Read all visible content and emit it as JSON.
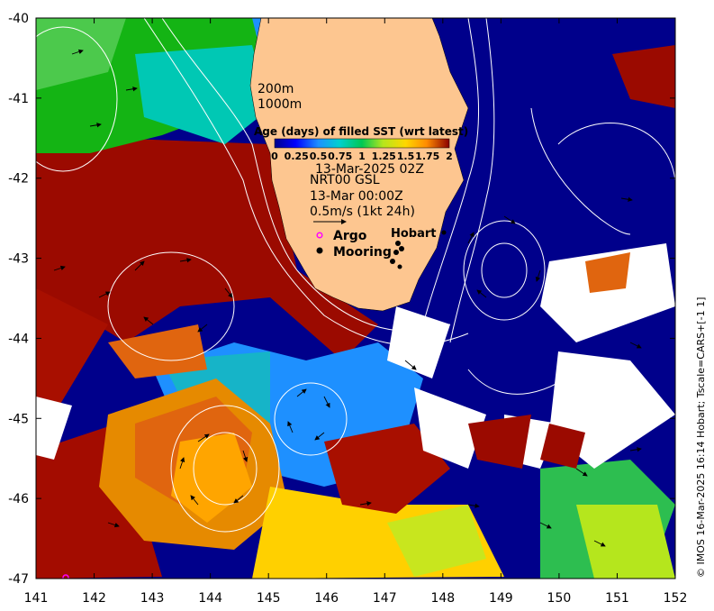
{
  "map": {
    "x_ticks": [
      "141",
      "142",
      "143",
      "144",
      "145",
      "146",
      "147",
      "148",
      "149",
      "150",
      "151",
      "152"
    ],
    "y_ticks": [
      "-40",
      "-41",
      "-42",
      "-43",
      "-44",
      "-45",
      "-46",
      "-47"
    ],
    "lon_range": [
      141,
      152
    ],
    "lat_range": [
      -47,
      -40
    ]
  },
  "legend": {
    "depth_200": "200m",
    "depth_1000": "1000m",
    "colorbar_title": "Age (days) of filled SST (wrt latest)",
    "colorbar_ticks": [
      "0",
      "0.25",
      "0.5",
      "0.75",
      "1",
      "1.25",
      "1.5",
      "1.75",
      "2"
    ],
    "colorbar_colors": [
      "#00008b",
      "#0000ff",
      "#1e90ff",
      "#00d0d0",
      "#00c853",
      "#b5e61d",
      "#ffd700",
      "#ff8c00",
      "#d2691e",
      "#8b0000"
    ],
    "sst_date": "13-Mar-2025 02Z",
    "current_label": "NRT00 GSL",
    "current_date": "13-Mar 00:00Z",
    "vector_scale": "0.5m/s (1kt 24h)",
    "argo_label": "Argo",
    "mooring_label": "Mooring",
    "hobart_label": "Hobart"
  },
  "credit": "© IMOS 16-Mar-2025 16:14 Hobart; Tscale=CARS+[-1 1]",
  "colors": {
    "land": "#fdc690",
    "dark_navy": "#00008b",
    "dark_red": "#9b0a00",
    "orange": "#e0650f",
    "argo_marker": "#ff00ff"
  }
}
